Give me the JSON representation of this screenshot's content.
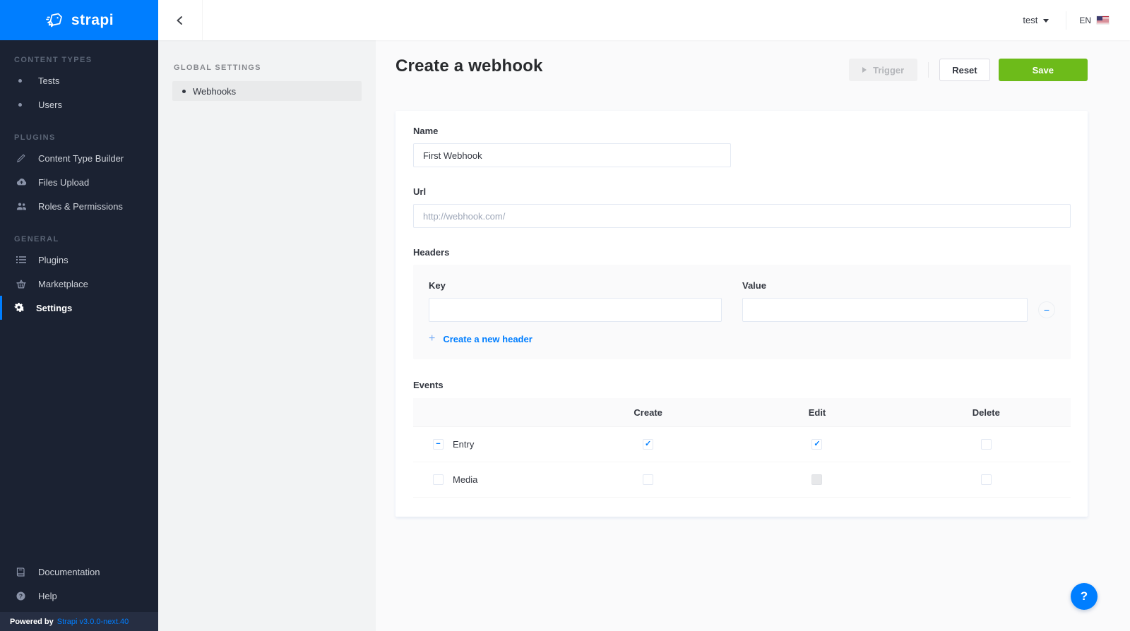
{
  "brand": {
    "name": "strapi"
  },
  "topbar": {
    "user_menu_label": "test",
    "locale_label": "EN"
  },
  "sidebar": {
    "sections": [
      {
        "title": "CONTENT TYPES",
        "items": [
          {
            "label": "Tests"
          },
          {
            "label": "Users"
          }
        ]
      },
      {
        "title": "PLUGINS",
        "items": [
          {
            "label": "Content Type Builder"
          },
          {
            "label": "Files Upload"
          },
          {
            "label": "Roles & Permissions"
          }
        ]
      },
      {
        "title": "GENERAL",
        "items": [
          {
            "label": "Plugins"
          },
          {
            "label": "Marketplace"
          },
          {
            "label": "Settings",
            "active": true
          }
        ]
      }
    ],
    "footer_items": [
      {
        "label": "Documentation"
      },
      {
        "label": "Help"
      }
    ],
    "powered_by": {
      "prefix": "Powered by",
      "link_text": "Strapi v3.0.0-next.40"
    }
  },
  "settings_nav": {
    "title": "GLOBAL SETTINGS",
    "items": [
      {
        "label": "Webhooks",
        "active": true
      }
    ]
  },
  "page": {
    "title": "Create a webhook",
    "actions": {
      "trigger_label": "Trigger",
      "reset_label": "Reset",
      "save_label": "Save"
    }
  },
  "form": {
    "name": {
      "label": "Name",
      "value": "First Webhook"
    },
    "url": {
      "label": "Url",
      "placeholder": "http://webhook.com/"
    },
    "headers": {
      "label": "Headers",
      "key_label": "Key",
      "key_value": "",
      "value_label": "Value",
      "value_value": "",
      "add_link_label": "Create a new header"
    },
    "events": {
      "label": "Events",
      "columns": [
        "Create",
        "Edit",
        "Delete"
      ],
      "rows": [
        {
          "name": "Entry",
          "row_checkbox": "indeterminate",
          "create": "checked",
          "edit": "checked",
          "delete": "unchecked"
        },
        {
          "name": "Media",
          "row_checkbox": "unchecked",
          "create": "unchecked",
          "edit": "disabled",
          "delete": "unchecked"
        }
      ]
    }
  },
  "help_button_label": "?",
  "colors": {
    "brand_blue": "#007eff",
    "save_green": "#6dbb1a",
    "sidebar_bg": "#1b2232",
    "link_blue": "#007eff"
  }
}
